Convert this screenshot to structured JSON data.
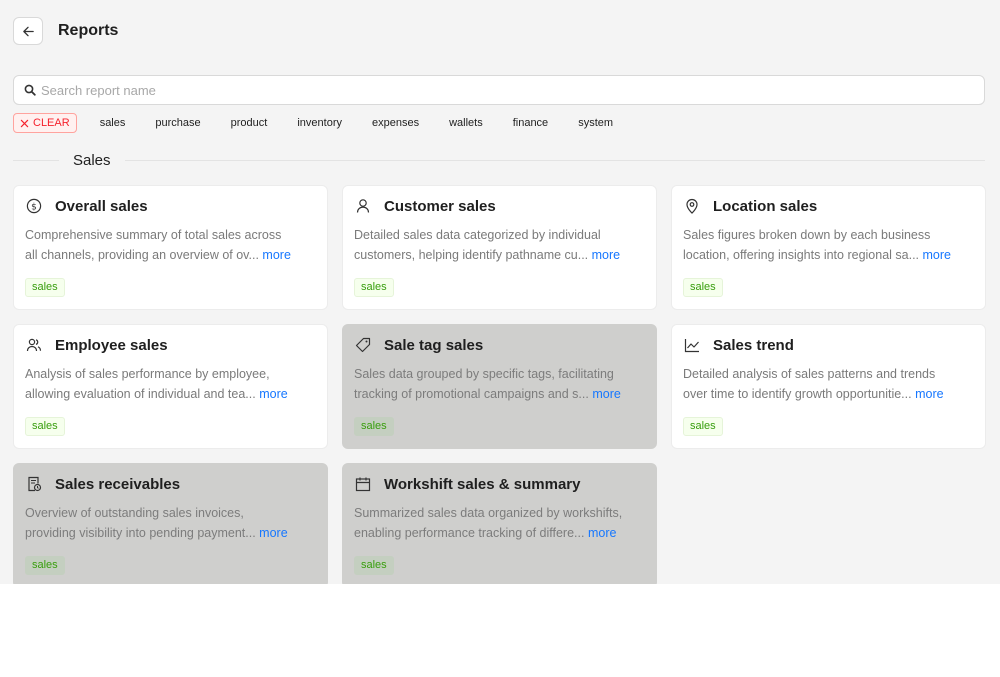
{
  "header": {
    "title": "Reports"
  },
  "search": {
    "placeholder": "Search report name",
    "value": ""
  },
  "filters": {
    "clear_label": "CLEAR",
    "tags": [
      "sales",
      "purchase",
      "product",
      "inventory",
      "expenses",
      "wallets",
      "finance",
      "system"
    ]
  },
  "section": {
    "title": "Sales"
  },
  "more_label": "more",
  "cards": [
    {
      "title": "Overall sales",
      "icon": "dollar-circle-icon",
      "desc_line1": "Comprehensive summary of total sales across",
      "desc_line2": "all channels, providing an overview of ov...",
      "tag": "sales",
      "state": "normal"
    },
    {
      "title": "Customer sales",
      "icon": "user-icon",
      "desc_line1": "Detailed sales data categorized by individual",
      "desc_line2": "customers, helping identify pathname cu...",
      "tag": "sales",
      "state": "normal"
    },
    {
      "title": "Location sales",
      "icon": "location-pin-icon",
      "desc_line1": "Sales figures broken down by each business",
      "desc_line2": "location, offering insights into regional sa...",
      "tag": "sales",
      "state": "normal"
    },
    {
      "title": "Employee sales",
      "icon": "team-icon",
      "desc_line1": "Analysis of sales performance by employee,",
      "desc_line2": "allowing evaluation of individual and tea...",
      "tag": "sales",
      "state": "normal"
    },
    {
      "title": "Sale tag sales",
      "icon": "tag-icon",
      "desc_line1": "Sales data grouped by specific tags, facilitating",
      "desc_line2": "tracking of promotional campaigns and s...",
      "tag": "sales",
      "state": "disabled"
    },
    {
      "title": "Sales trend",
      "icon": "line-chart-icon",
      "desc_line1": "Detailed analysis of sales patterns and trends",
      "desc_line2": "over time to identify growth opportunitie...",
      "tag": "sales",
      "state": "normal"
    },
    {
      "title": "Sales receivables",
      "icon": "receipt-icon",
      "desc_line1": "Overview of outstanding sales invoices,",
      "desc_line2": "providing visibility into pending payment...",
      "tag": "sales",
      "state": "disabled"
    },
    {
      "title": "Workshift sales & summary",
      "icon": "calendar-icon",
      "desc_line1": "Summarized sales data organized by workshifts,",
      "desc_line2": "enabling performance tracking of differe...",
      "tag": "sales",
      "state": "disabled"
    }
  ]
}
